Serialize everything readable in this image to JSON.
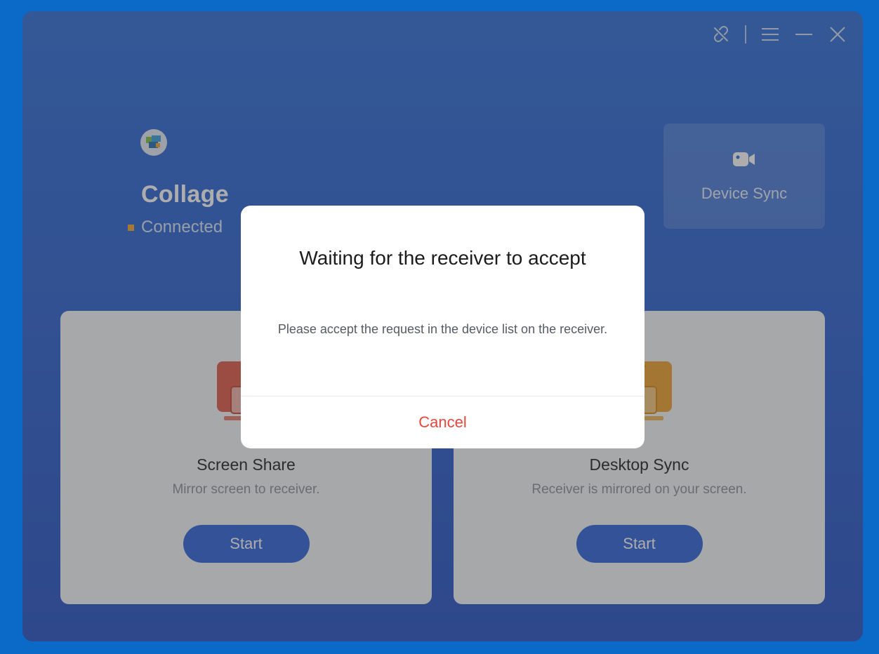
{
  "window": {
    "titlebar": {
      "icons": [
        "link-off-icon",
        "menu-icon",
        "minimize-icon",
        "close-icon"
      ]
    }
  },
  "device": {
    "name": "Collage",
    "status": "Connected",
    "status_color": "#f2a531"
  },
  "device_sync": {
    "label": "Device Sync",
    "icon": "video-camera-icon"
  },
  "cards": [
    {
      "title": "Screen Share",
      "description": "Mirror screen to receiver.",
      "button": "Start",
      "icon": "screen-share-icon",
      "color": "#e05a4b"
    },
    {
      "title": "Desktop Sync",
      "description": "Receiver is mirrored on your screen.",
      "button": "Start",
      "icon": "desktop-sync-icon",
      "color": "#f0a12e"
    }
  ],
  "modal": {
    "title": "Waiting for the receiver to accept",
    "message": "Please accept the request in the device list on the receiver.",
    "cancel": "Cancel"
  },
  "colors": {
    "accent": "#2f63d9",
    "background": "#0b6ac7",
    "danger": "#e8463c"
  }
}
